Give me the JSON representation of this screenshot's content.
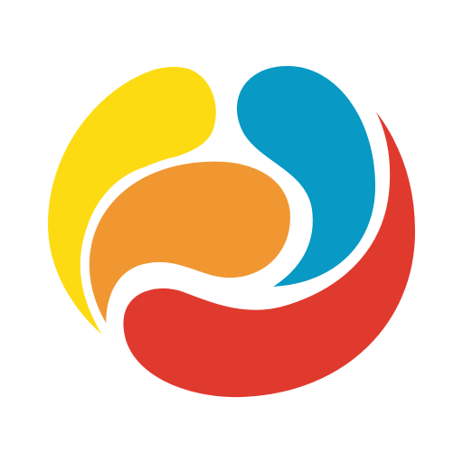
{
  "background": "#ffffff",
  "logo": {
    "shapes": [
      {
        "name": "red-swirl",
        "color": "#e03a2e"
      },
      {
        "name": "blue-swirl",
        "color": "#0899c4"
      },
      {
        "name": "yellow-swirl",
        "color": "#fcdb13"
      },
      {
        "name": "orange-swirl",
        "color": "#f09731"
      }
    ],
    "gap_color": "#ffffff"
  }
}
